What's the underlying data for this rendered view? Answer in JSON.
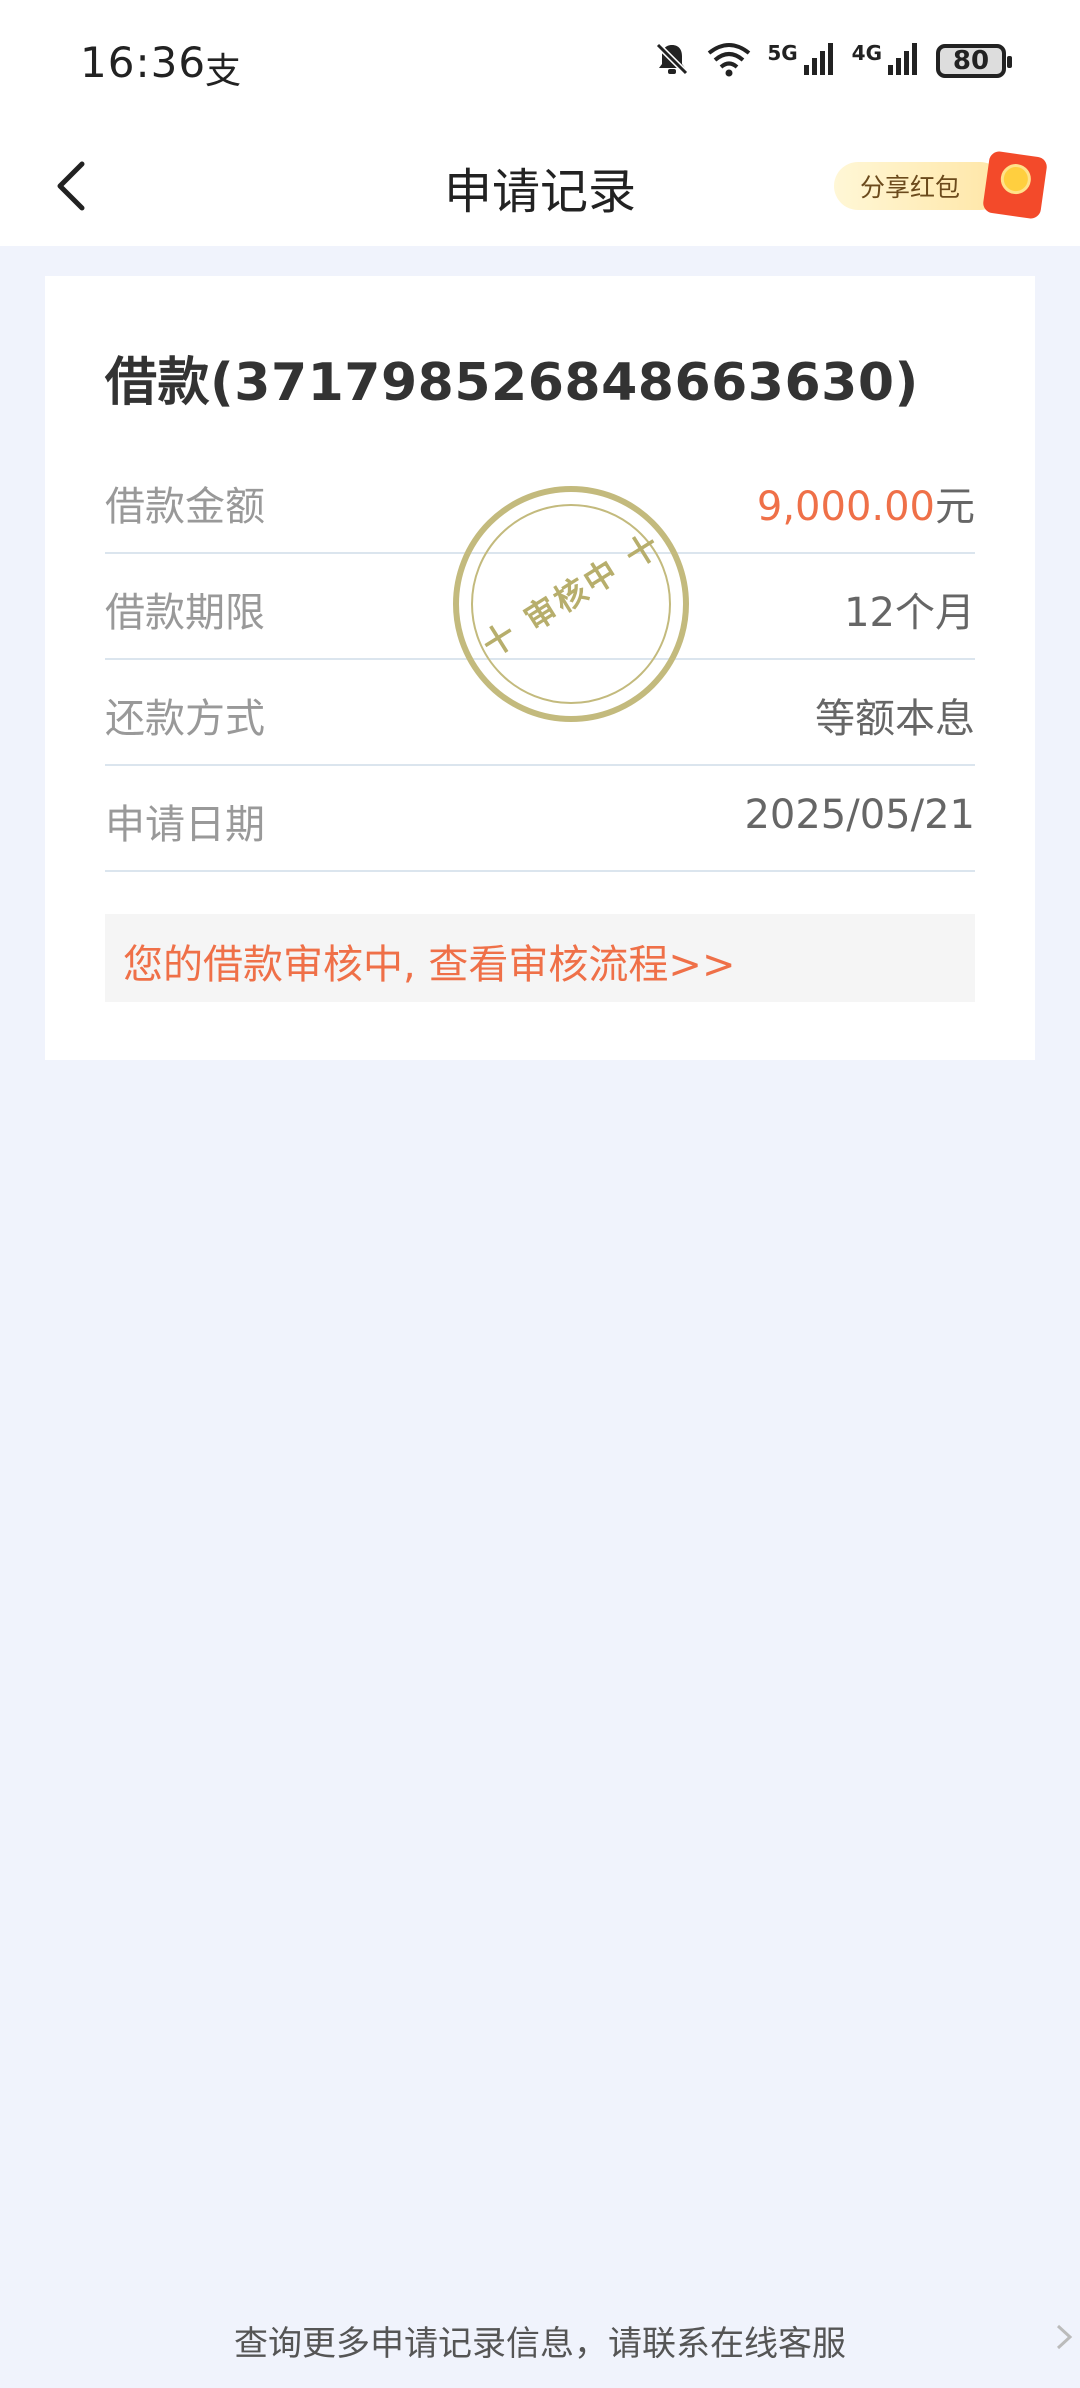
{
  "status_bar": {
    "time": "16:36",
    "alipay_glyph": "支",
    "network_5g": "5G",
    "network_4g": "4G",
    "battery": "80",
    "icons": [
      "bell-muted-icon",
      "wifi-icon",
      "signal-5g-icon",
      "signal-4g-icon",
      "battery-icon"
    ]
  },
  "header": {
    "title": "申请记录",
    "back_icon": "chevron-left-icon",
    "share_label": "分享红包"
  },
  "record": {
    "title": "借款(371798526848663630)",
    "rows": [
      {
        "label": "借款金额",
        "value": "9,000.00",
        "unit": "元"
      },
      {
        "label": "借款期限",
        "value": "12个月"
      },
      {
        "label": "还款方式",
        "value": "等额本息"
      },
      {
        "label": "申请日期",
        "value": "2025/05/21"
      }
    ],
    "stamp": "十 审核中 十",
    "review_link": "您的借款审核中, 查看审核流程>>"
  },
  "footer": {
    "note": "查询更多申请记录信息，请联系在线客服"
  },
  "colors": {
    "background": "#f0f3fc",
    "accent_orange": "#ef7048",
    "stamp": "#c3ba7d",
    "divider": "#dbe5ee"
  }
}
